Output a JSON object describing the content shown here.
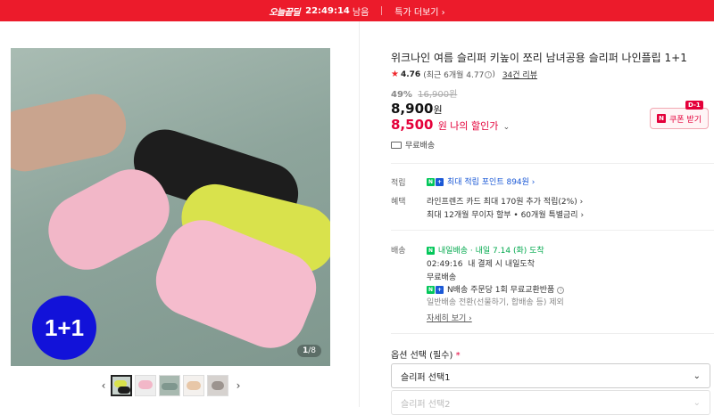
{
  "promo": {
    "logo": "오늘끝딜",
    "timer": "22:49:14",
    "remaining": "남음",
    "more": "특가 더보기 ›"
  },
  "gallery": {
    "badge": "1+1",
    "page_current": "1",
    "page_total": "/8",
    "prev_arrow": "‹",
    "next_arrow": "›"
  },
  "product": {
    "title": "위크나인 여름 슬리퍼 키높이 쪼리 남녀공용 슬리퍼 나인플립 1+1",
    "rating": "4.76",
    "rating_recent": "(최근 6개월 4.77",
    "rating_recent_close": ")",
    "reviews": "34건 리뷰",
    "discount_rate": "49%",
    "original_price": "16,900원",
    "price": "8,900",
    "price_unit": "원",
    "my_price": "8,500",
    "my_price_label": "원 나의 할인가",
    "shipping_tag": "무료배송",
    "coupon_label": "쿠폰 받기",
    "coupon_dday": "D-1"
  },
  "benefits": {
    "point_label": "적립",
    "point_text": "최대 적립 포인트 894원 ›",
    "perks_label": "혜택",
    "perk1": "라인프렌즈 카드 최대 170원 추가 적립(2%) ›",
    "perk2": "최대 12개월 무이자 할부 • 60개월 특별금리 ›",
    "delivery_label": "배송",
    "delivery_brand": "내일배송",
    "delivery_date": "· 내일 7.14 (화) 도착",
    "delivery_cutoff_time": "02:49:16",
    "delivery_cutoff_text": "내 결제 시 내일도착",
    "delivery_free": "무료배송",
    "delivery_exchange": "N배송 주문당 1회 무료교환반품",
    "delivery_note": "일반배송 전환(선물하기, 합배송 등) 제외",
    "detail_link": "자세히 보기 ›"
  },
  "options": {
    "label": "옵션 선택 (필수)",
    "required_mark": "*",
    "select1": "슬리퍼 선택1",
    "select2": "슬리퍼 선택2"
  },
  "colors": {
    "accent_red": "#e4003a",
    "banner_red": "#ec1b2b",
    "naver_green": "#03c75a",
    "badge_blue": "#1212d9"
  }
}
